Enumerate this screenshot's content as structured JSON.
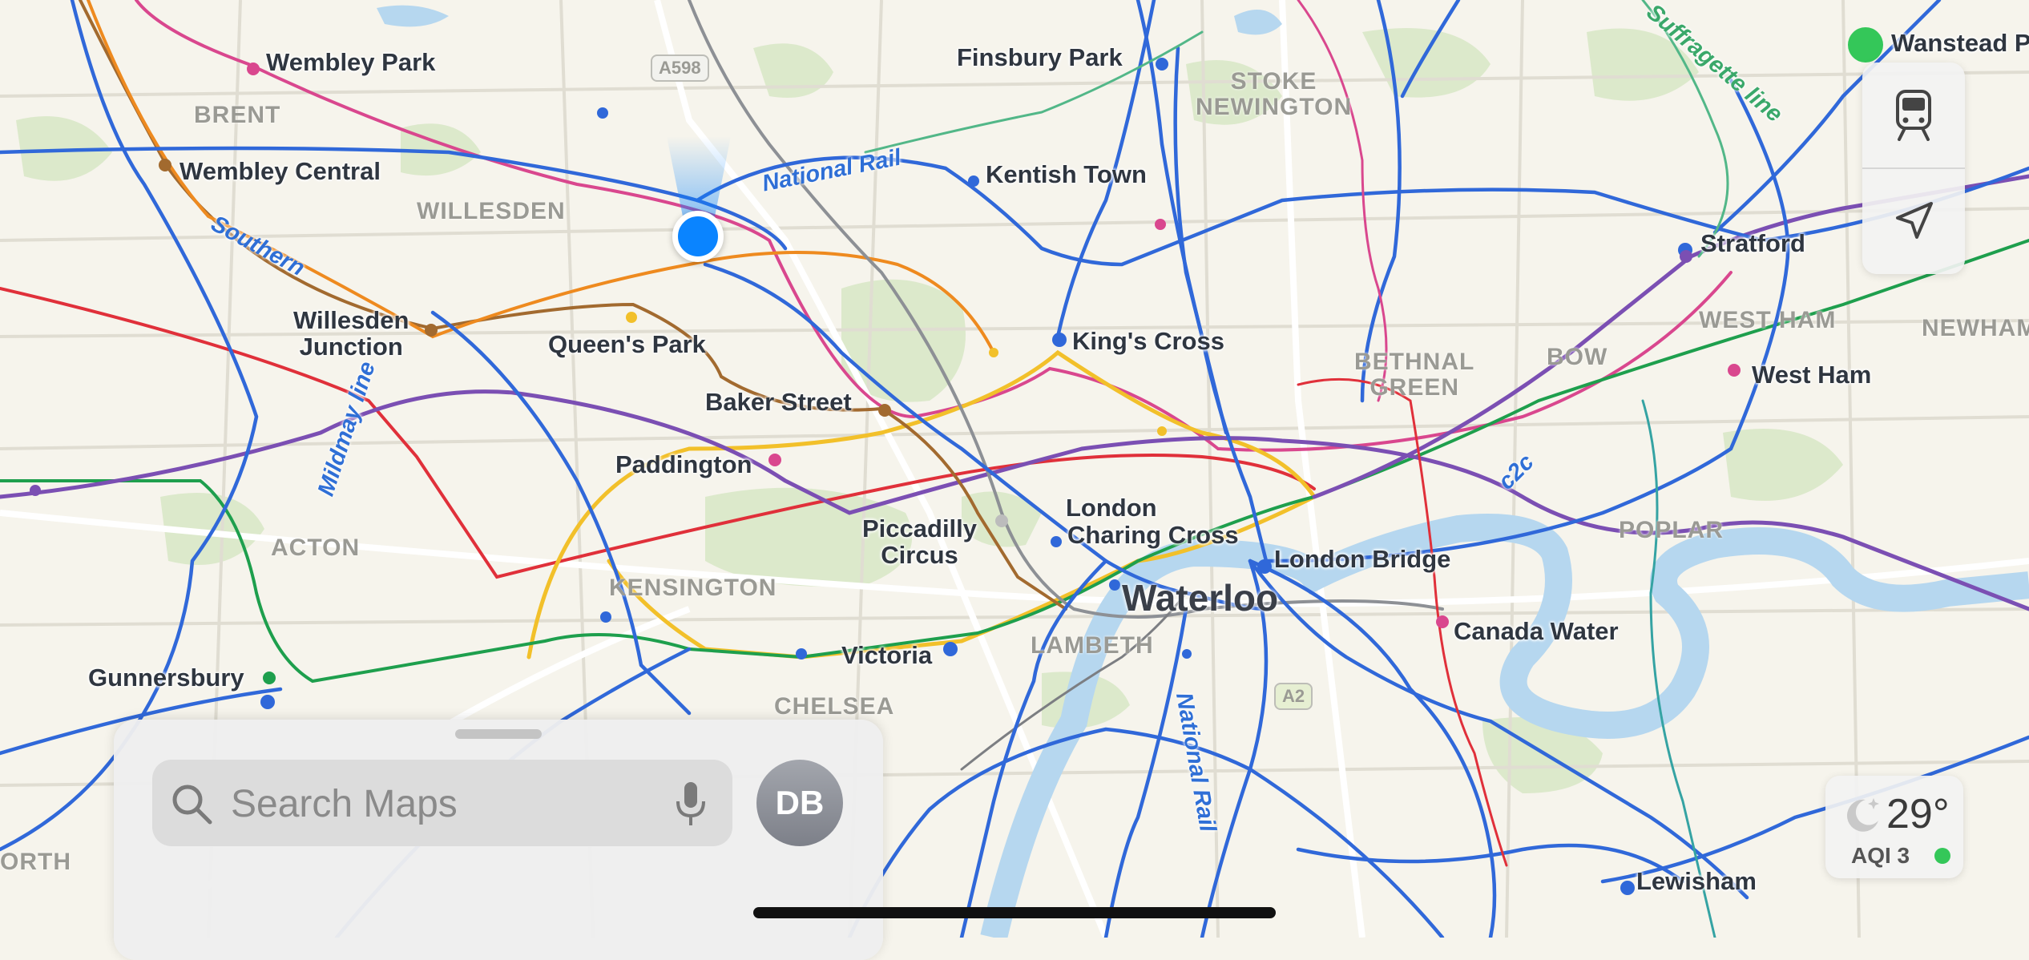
{
  "map": {
    "stations": {
      "wembley_park": "Wembley Park",
      "finsbury_park": "Finsbury Park",
      "wanstead_park": "Wanstead P",
      "wembley_central": "Wembley Central",
      "kentish_town": "Kentish Town",
      "stratford": "Stratford",
      "willesden_junction": "Willesden\nJunction",
      "queens_park": "Queen's Park",
      "kings_cross": "King's Cross",
      "west_ham": "West Ham",
      "baker_street": "Baker Street",
      "paddington": "Paddington",
      "london": "London",
      "charing_cross": "Charing Cross",
      "piccadilly_circus": "Piccadilly\nCircus",
      "london_bridge": "London Bridge",
      "waterloo": "Waterloo",
      "canada_water": "Canada Water",
      "victoria": "Victoria",
      "gunnersbury": "Gunnersbury",
      "lewisham": "Lewisham"
    },
    "areas": {
      "brent": "BRENT",
      "willesden": "WILLESDEN",
      "stoke_newington": "STOKE\nNEWINGTON",
      "bethnal_green": "BETHNAL\nGREEN",
      "bow": "BOW",
      "west_ham_area": "WEST HAM",
      "newham": "NEWHAM",
      "acton": "ACTON",
      "kensington": "KENSINGTON",
      "lambeth": "LAMBETH",
      "chelsea": "CHELSEA",
      "poplar": "POPLAR",
      "north": "ORTH"
    },
    "lines": {
      "national_rail": "National Rail",
      "national_rail_2": "National Rail",
      "southern": "Southern",
      "mildmay": "Mildmay line",
      "suffragette": "Suffragette line",
      "c2c": "c2c"
    },
    "roads": {
      "a598": "A598",
      "a2": "A2"
    }
  },
  "controls": {
    "transit_icon": "train-icon",
    "location_icon": "location-arrow-icon"
  },
  "weather": {
    "temperature": "29°",
    "aqi": "AQI 3",
    "icon": "moon-stars-icon",
    "aqi_color": "#34c759"
  },
  "search": {
    "placeholder": "Search Maps",
    "avatar_initials": "DB"
  },
  "colors": {
    "user_location": "#0a84ff",
    "rail_blue": "#2f6fd6"
  }
}
